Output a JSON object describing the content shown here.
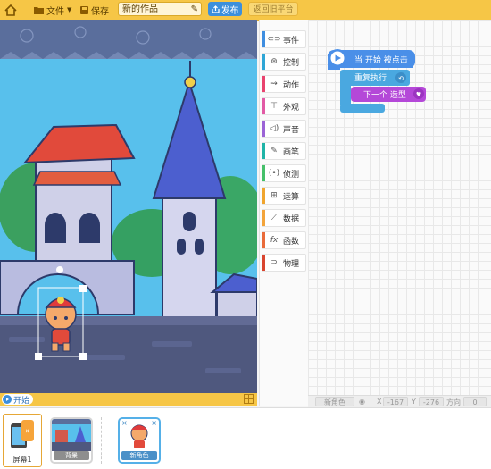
{
  "topbar": {
    "file_label": "文件",
    "save_label": "保存",
    "project_name": "新的作品",
    "publish_label": "发布",
    "return_label": "返回旧平台"
  },
  "stage": {
    "start_label": "开始"
  },
  "palette": {
    "categories": [
      {
        "label": "事件",
        "icon": "toggle-icon",
        "color": "#3f8ee0"
      },
      {
        "label": "控制",
        "icon": "gamepad-icon",
        "color": "#2fa6d6"
      },
      {
        "label": "动作",
        "icon": "run-icon",
        "color": "#e9436e"
      },
      {
        "label": "外观",
        "icon": "shirt-icon",
        "color": "#e25aa5"
      },
      {
        "label": "声音",
        "icon": "speaker-icon",
        "color": "#9b63d6"
      },
      {
        "label": "画笔",
        "icon": "pencil-icon",
        "color": "#1fb4a7"
      },
      {
        "label": "侦测",
        "icon": "radar-icon",
        "color": "#45c06a"
      },
      {
        "label": "运算",
        "icon": "calc-icon",
        "color": "#f0a52e"
      },
      {
        "label": "数据",
        "icon": "chart-icon",
        "color": "#f3a43b"
      },
      {
        "label": "函数",
        "icon": "fx-icon",
        "color": "#e96b3a"
      },
      {
        "label": "物理",
        "icon": "magnet-icon",
        "color": "#d9452f"
      }
    ]
  },
  "code": {
    "hat_block": "当 开始 被点击",
    "repeat_block": "重复执行",
    "next_costume_block": "下一个 造型"
  },
  "coords": {
    "sprite_name": "新角色",
    "x_label": "X",
    "x_value": "-167",
    "y_label": "Y",
    "y_value": "-276",
    "direction_label": "方向",
    "direction_value": "0"
  },
  "sprites": {
    "scene_label": "屏幕1",
    "background_label": "背景",
    "sprite_label": "新角色"
  },
  "colors": {
    "accent": "#f6c646",
    "event_block": "#4a8fe8",
    "looks_block": "#b448d8"
  }
}
